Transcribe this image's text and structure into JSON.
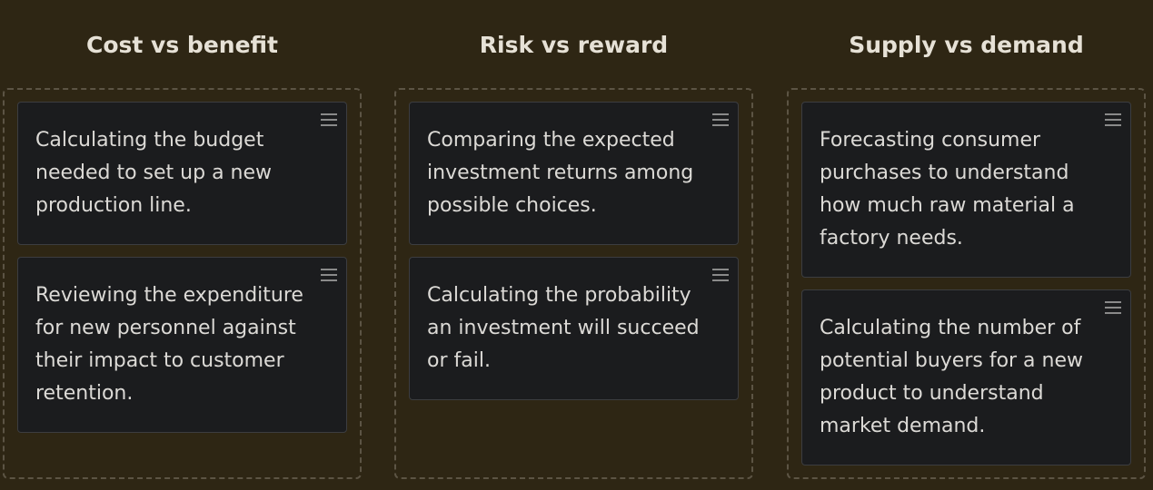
{
  "columns": [
    {
      "title": "Cost vs benefit",
      "cards": [
        {
          "text": "Calculating the budget needed to set up a new production line."
        },
        {
          "text": "Reviewing the expenditure for new personnel against their impact to customer retention."
        }
      ]
    },
    {
      "title": "Risk vs reward",
      "cards": [
        {
          "text": "Comparing the expected investment returns among possible choices."
        },
        {
          "text": "Calculating the probability an investment will succeed or fail."
        }
      ]
    },
    {
      "title": "Supply vs demand",
      "cards": [
        {
          "text": "Forecasting consumer purchases to understand how much raw material a factory needs."
        },
        {
          "text": "Calculating the number of potential buyers for a new product to understand market demand."
        }
      ]
    }
  ],
  "icons": {
    "drag_handle": "drag-handle-icon"
  },
  "colors": {
    "background": "#2e2614",
    "card_background": "#1b1c1e",
    "title_text": "#e6e1d6",
    "card_text": "#dcdad6",
    "dropzone_border": "#5c5444"
  }
}
